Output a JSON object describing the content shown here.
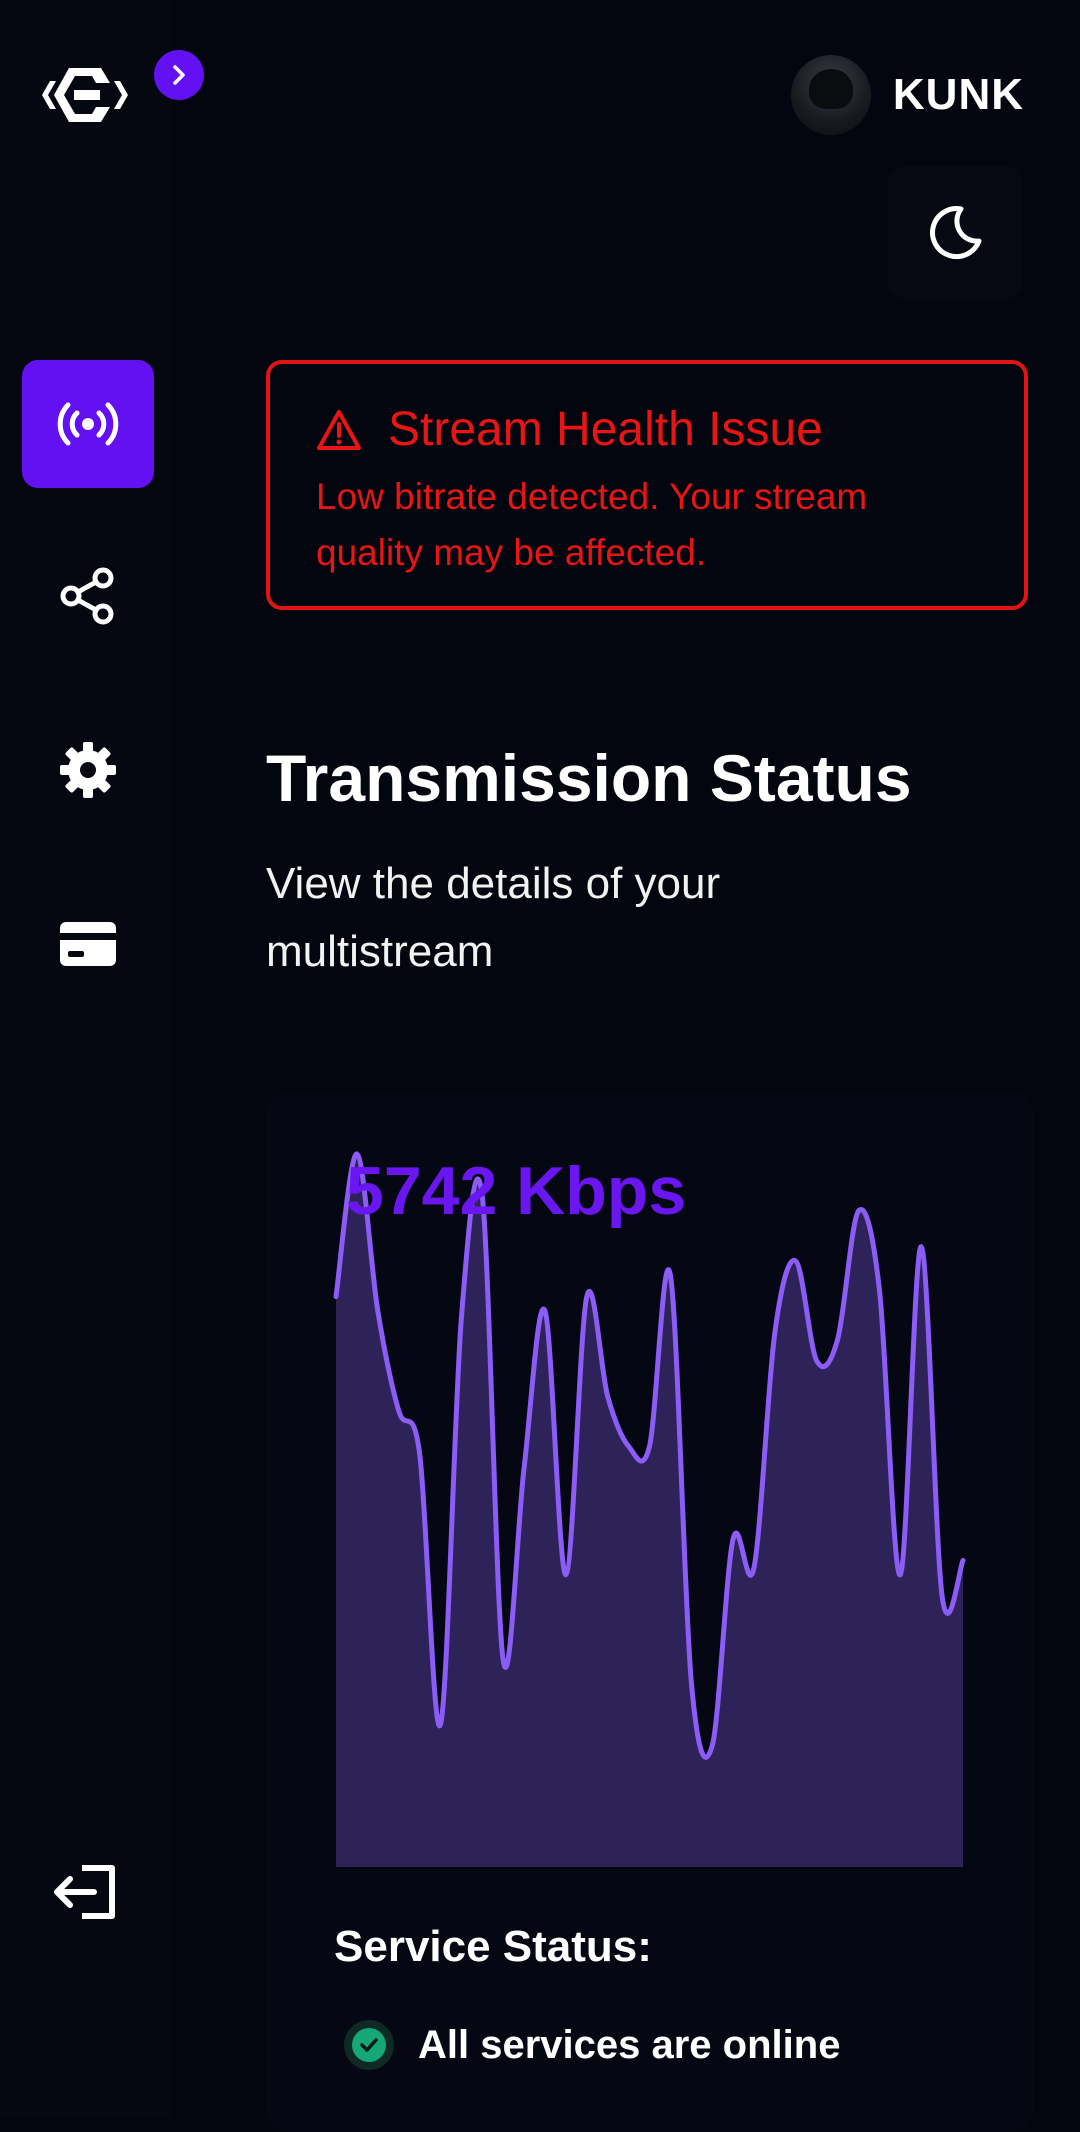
{
  "header": {
    "username": "KUNK"
  },
  "sidebar": {
    "items": [
      {
        "name": "broadcast",
        "icon": "broadcast-icon",
        "active": true
      },
      {
        "name": "share",
        "icon": "share-icon",
        "active": false
      },
      {
        "name": "settings",
        "icon": "gear-icon",
        "active": false
      },
      {
        "name": "billing",
        "icon": "credit-card-icon",
        "active": false
      }
    ],
    "logout_icon": "logout-icon"
  },
  "alert": {
    "title": "Stream Health Issue",
    "message": "Low bitrate detected. Your stream quality may be affected.",
    "color": "#e01414"
  },
  "main": {
    "title": "Transmission Status",
    "subtitle": "View the details of your multistream"
  },
  "chart_data": {
    "type": "area",
    "title": "5742 Kbps",
    "values": [
      0.8,
      1.0,
      0.78,
      0.64,
      0.58,
      0.2,
      0.77,
      0.94,
      0.29,
      0.56,
      0.78,
      0.41,
      0.8,
      0.66,
      0.59,
      0.59,
      0.83,
      0.26,
      0.17,
      0.46,
      0.42,
      0.75,
      0.85,
      0.71,
      0.74,
      0.92,
      0.81,
      0.41,
      0.87,
      0.38,
      0.43
    ],
    "line_color": "#8b5cf6",
    "fill_color": "#2e2358"
  },
  "service": {
    "title": "Service Status:",
    "status": "All services are online",
    "status_color": "#15a876"
  },
  "colors": {
    "accent": "#6310f2",
    "background": "#04060f"
  }
}
